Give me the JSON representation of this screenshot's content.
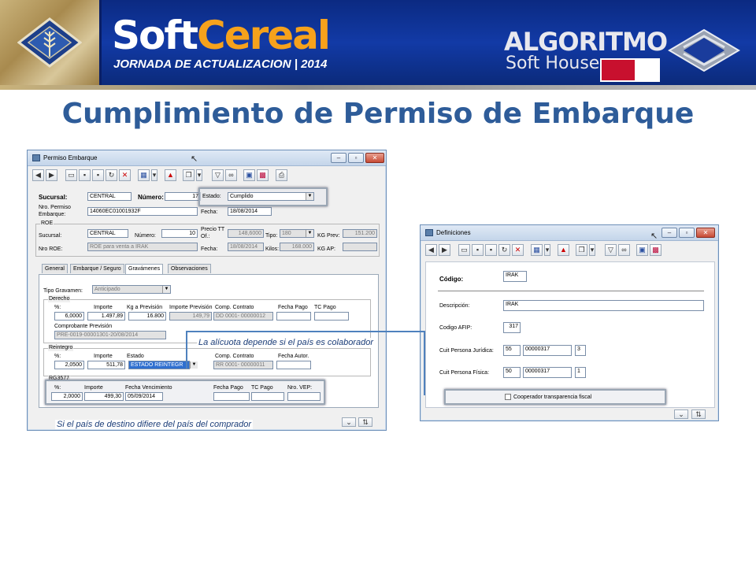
{
  "banner": {
    "brand_soft": "Soft",
    "brand_cereal": "Cereal",
    "brand_sub": "JORNADA DE ACTUALIZACION | 2014",
    "alg_title": "ALGORITMO",
    "alg_sub": "Soft House",
    "colors": {
      "banner": "#123aa6",
      "brand_accent": "#f6a21c"
    }
  },
  "slide_title": "Cumplimiento de Permiso de Embarque",
  "main_window": {
    "title": "Permiso Embarque",
    "sucursal_label": "Sucursal:",
    "sucursal_value": "CENTRAL",
    "numero_label": "Número:",
    "numero_value": "17",
    "estado_label": "Estado:",
    "estado_value": "Cumplido",
    "nro_permiso_label": "Nro. Permiso Embarque:",
    "nro_permiso_value": "14060EC01001932F",
    "fecha_label": "Fecha:",
    "fecha_value": "18/08/2014",
    "roe": {
      "group": "ROE",
      "sucursal_label": "Sucursal:",
      "sucursal_value": "CENTRAL",
      "numero_label": "Número:",
      "numero_value": "10",
      "precio_label": "Precio TT Of.:",
      "precio_value": "148,6000",
      "tipo_label": "Tipo:",
      "tipo_value": "180",
      "kgprev_label": "KG Prev:",
      "kgprev_value": "151.200",
      "nro_roe_label": "Nro ROE:",
      "nro_roe_value": "ROE para venta a IRAK",
      "fecha_label": "Fecha:",
      "fecha_value": "18/08/2014",
      "kilos_label": "Kilos:",
      "kilos_value": "168.000",
      "kgap_label": "KG AP:"
    },
    "tabs": [
      "General",
      "Embarque / Seguro",
      "Gravámenes",
      "Observaciones"
    ],
    "tipo_gravamen_label": "Tipo Gravamen:",
    "tipo_gravamen_value": "Anticipado",
    "derecho": {
      "group": "Derecho",
      "headers": [
        "%:",
        "Importe",
        "Kg a Previsión",
        "Importe Previsión",
        "Comp. Contrato",
        "Fecha Pago",
        "TC Pago"
      ],
      "values": [
        "6,0000",
        "1.497,89",
        "16.800",
        "149,79",
        "DD  0001- 00000012",
        "",
        ""
      ],
      "comprobante_label": "Comprobante Previsión",
      "comprobante_value": "PRE-0019-00001301-20/08/2014"
    },
    "reintegro": {
      "group": "Reintegro",
      "headers": [
        "%:",
        "Importe",
        "Estado",
        "Comp. Contrato",
        "Fecha Autor."
      ],
      "values": [
        "2,0500",
        "511,78",
        "ESTADO REINTEGR",
        "RR  0001- 00000011",
        ""
      ]
    },
    "rg": {
      "group": "RG3577",
      "headers": [
        "%:",
        "Importe",
        "Fecha Vencimiento",
        "Fecha Pago",
        "TC Pago",
        "Nro. VEP:"
      ],
      "values": [
        "2,0000",
        "499,30",
        "05/09/2014",
        "",
        "",
        ""
      ]
    }
  },
  "def_window": {
    "title": "Definiciones",
    "codigo_label": "Código:",
    "codigo_value": "IRAK",
    "descripcion_label": "Descripción:",
    "descripcion_value": "IRAK",
    "afip_label": "Codigo AFIP:",
    "afip_value": "317",
    "cuit_juridica_label": "Cuit Persona Jurídica:",
    "cuit_juridica_values": [
      "55",
      "00000317",
      "3"
    ],
    "cuit_fisica_label": "Cuit Persona Física:",
    "cuit_fisica_values": [
      "50",
      "00000317",
      "1"
    ],
    "cooperador_label": "Cooperador transparencia fiscal"
  },
  "annotations": {
    "alicuota": "La alícuota depende si el país es colaborador",
    "destino": "Si el país de destino difiere del país del comprador"
  }
}
